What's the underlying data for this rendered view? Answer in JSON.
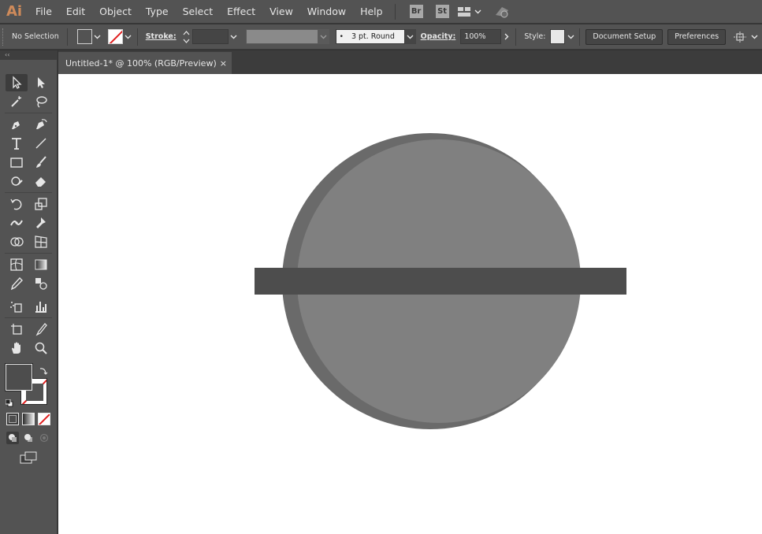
{
  "app": {
    "logo": "Ai"
  },
  "menu": [
    "File",
    "Edit",
    "Object",
    "Type",
    "Select",
    "Effect",
    "View",
    "Window",
    "Help"
  ],
  "menubar_icons": {
    "bridge": "Br",
    "stock": "St"
  },
  "control": {
    "selection_status": "No Selection",
    "stroke_label": "Stroke:",
    "brush_value": "3 pt. Round",
    "opacity_label": "Opacity:",
    "opacity_value": "100%",
    "style_label": "Style:",
    "document_setup": "Document Setup",
    "preferences": "Preferences"
  },
  "document": {
    "tab_title": "Untitled-1* @ 100% (RGB/Preview)",
    "close_symbol": "×"
  },
  "colors": {
    "ui_panel": "#535353",
    "ui_dark": "#3c3c3c",
    "canvas": "#ffffff",
    "circle_main": "#808080",
    "circle_shadow": "#6a6a6a",
    "bar": "#4d4d4d",
    "logo": "#ce8a5a"
  },
  "tools": [
    "selection-tool",
    "direct-selection-tool",
    "magic-wand-tool",
    "lasso-tool",
    "pen-tool",
    "curvature-tool",
    "type-tool",
    "line-segment-tool",
    "rectangle-tool",
    "paintbrush-tool",
    "shaper-tool",
    "eraser-tool",
    "rotate-tool",
    "scale-tool",
    "width-tool",
    "puppet-warp-tool",
    "shape-builder-tool",
    "perspective-grid-tool",
    "mesh-tool",
    "gradient-tool",
    "eyedropper-tool",
    "blend-tool",
    "symbol-sprayer-tool",
    "column-graph-tool",
    "artboard-tool",
    "slice-tool",
    "hand-tool",
    "zoom-tool"
  ]
}
